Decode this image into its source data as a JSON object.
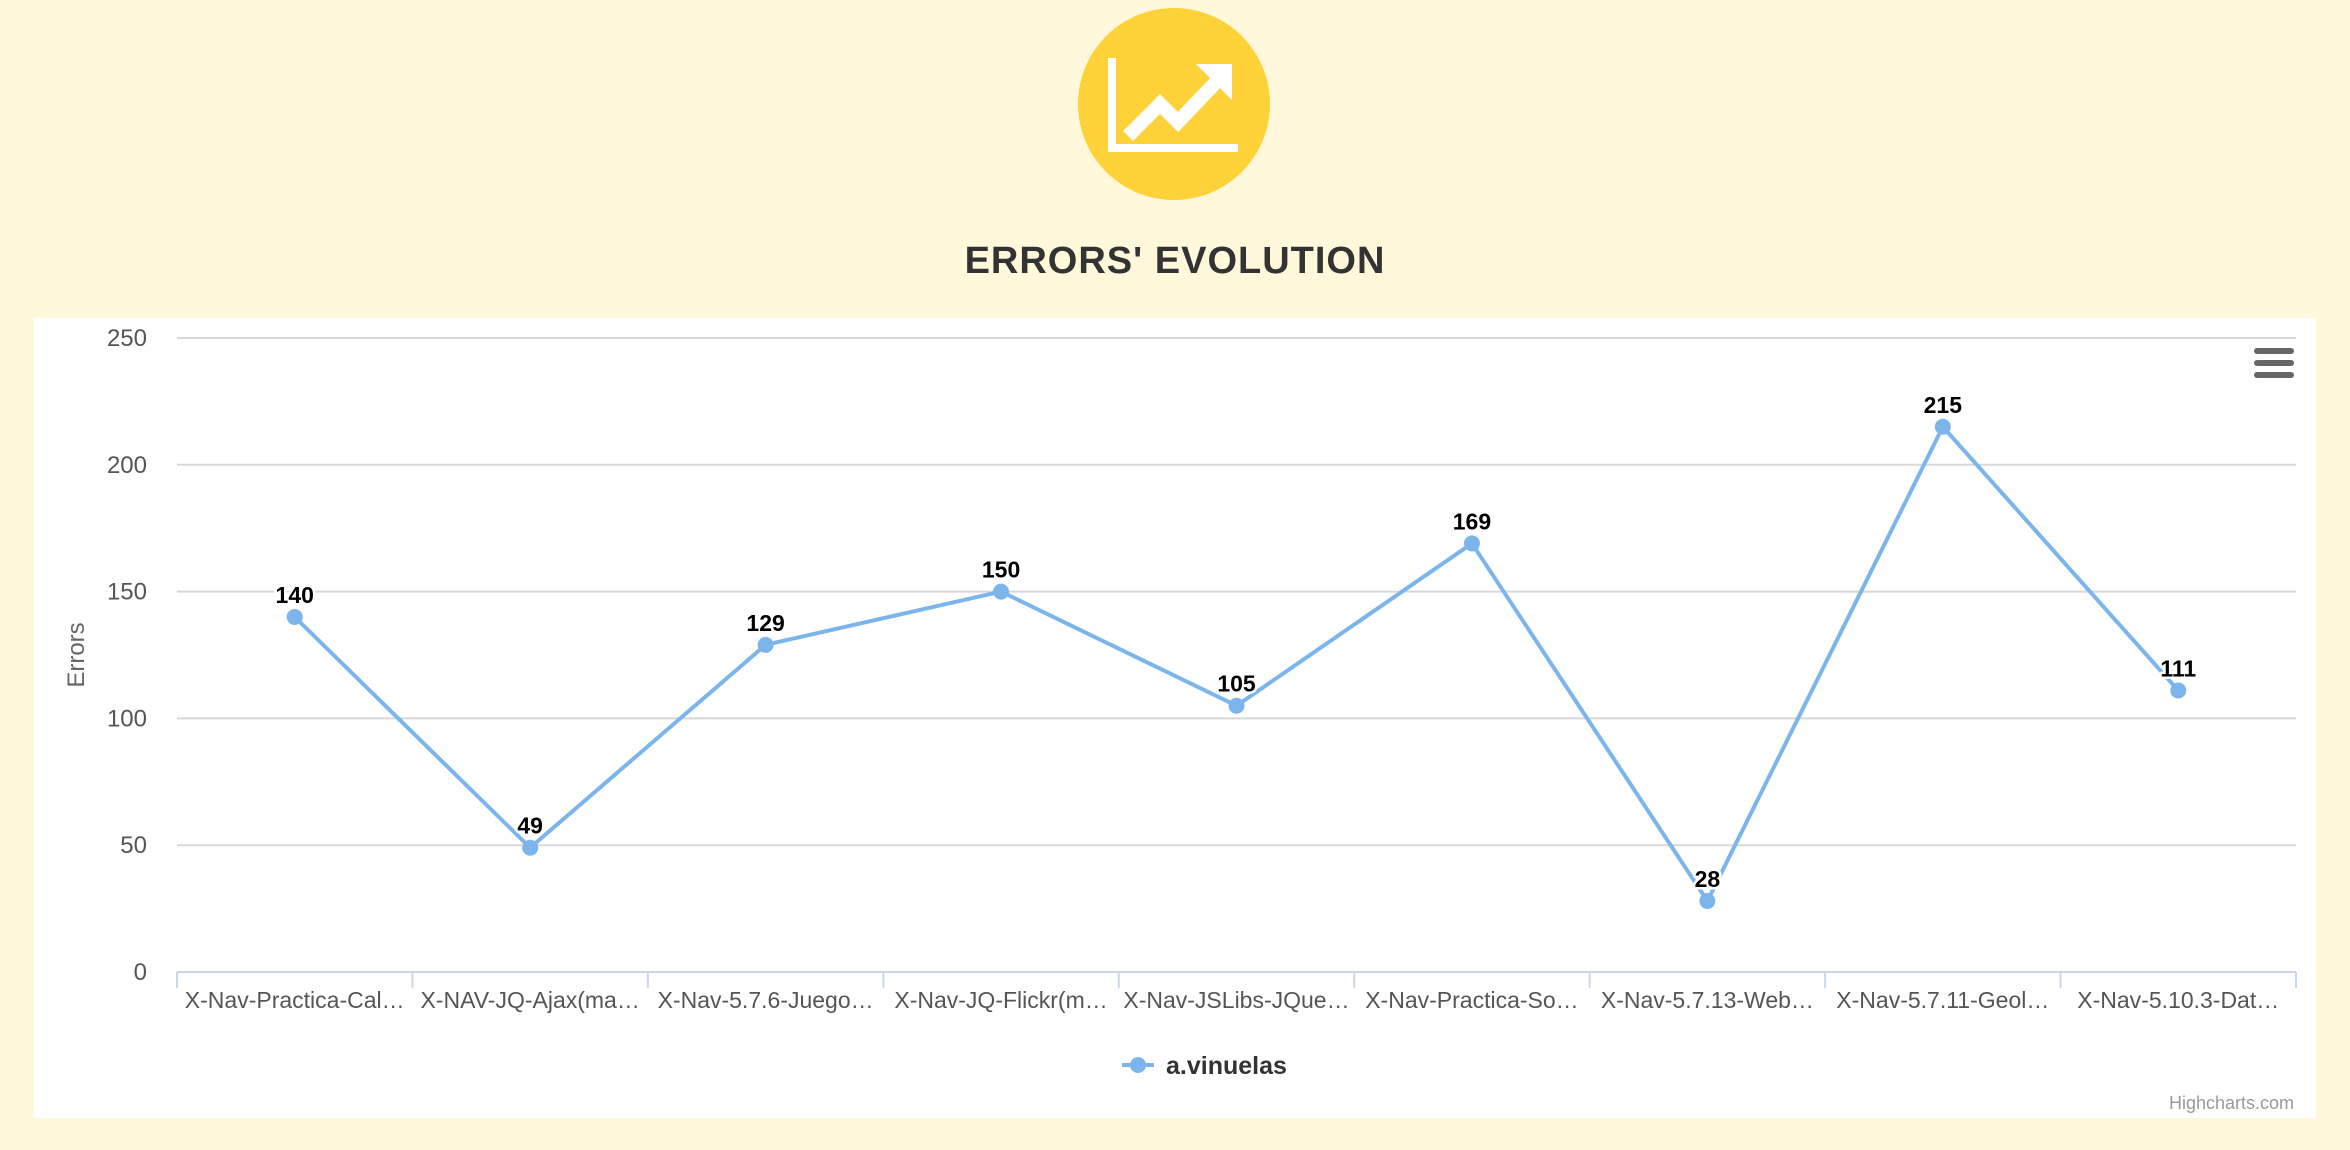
{
  "header": {
    "logo_icon": "trend-chart-icon",
    "title": "ERRORS' EVOLUTION"
  },
  "credits": "Highcharts.com",
  "menu_icon": "hamburger-menu-icon",
  "colors": {
    "background": "#fff8db",
    "logo": "#ffd23a",
    "series": "#7cb5ec"
  },
  "chart_data": {
    "type": "line",
    "title": "",
    "xlabel": "",
    "ylabel": "Errors",
    "ylim": [
      0,
      250
    ],
    "yticks": [
      0,
      50,
      100,
      150,
      200,
      250
    ],
    "grid": true,
    "legend": "bottom-center",
    "categories": [
      "X-Nav-Practica-Cal…",
      "X-NAV-JQ-Ajax(ma…",
      "X-Nav-5.7.6-Juego…",
      "X-Nav-JQ-Flickr(m…",
      "X-Nav-JSLibs-JQue…",
      "X-Nav-Practica-So…",
      "X-Nav-5.7.13-Web…",
      "X-Nav-5.7.11-Geol…",
      "X-Nav-5.10.3-Dat…"
    ],
    "series": [
      {
        "name": "a.vinuelas",
        "color": "#7cb5ec",
        "values": [
          140,
          49,
          129,
          150,
          105,
          169,
          28,
          215,
          111
        ]
      }
    ]
  }
}
